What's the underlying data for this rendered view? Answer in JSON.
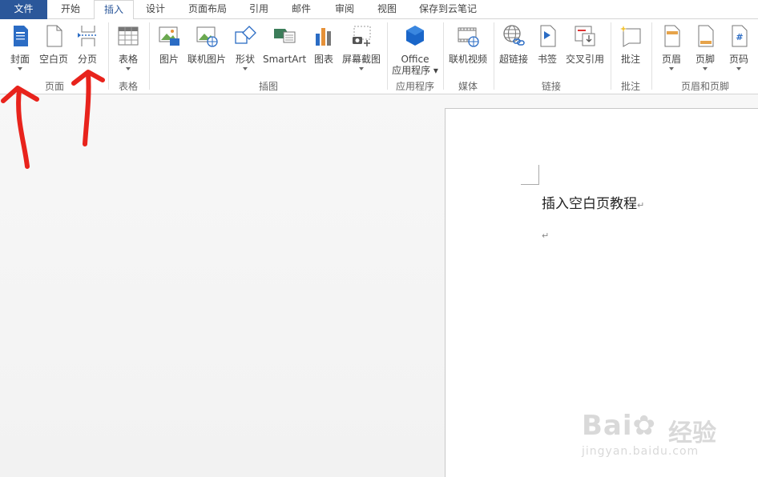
{
  "tabs": [
    "文件",
    "开始",
    "插入",
    "设计",
    "页面布局",
    "引用",
    "邮件",
    "审阅",
    "视图",
    "保存到云笔记"
  ],
  "active_tab": "插入",
  "ribbon": {
    "page_group": {
      "label": "页面",
      "cover": "封面",
      "blank_page": "空白页",
      "page_break": "分页"
    },
    "table_group": {
      "label": "表格",
      "table": "表格"
    },
    "illustrations_group": {
      "label": "插图",
      "picture": "图片",
      "online_picture": "联机图片",
      "shapes": "形状",
      "smartart": "SmartArt",
      "chart": "图表",
      "screenshot": "屏幕截图"
    },
    "apps_group": {
      "label": "应用程序",
      "office_line1": "Office",
      "office_line2": "应用程序"
    },
    "media_group": {
      "label": "媒体",
      "online_video": "联机视频"
    },
    "links_group": {
      "label": "链接",
      "hyperlink": "超链接",
      "bookmark": "书签",
      "cross_reference": "交叉引用"
    },
    "comments_group": {
      "label": "批注",
      "comment": "批注"
    },
    "header_footer_group": {
      "label": "页眉和页脚",
      "header": "页眉",
      "footer": "页脚",
      "page_number": "页码"
    }
  },
  "document": {
    "line1": "插入空白页教程",
    "paragraph_mark": "↵"
  },
  "watermark": {
    "brand": "Bai",
    "brand_tail": "经验",
    "url": "jingyan.baidu.com"
  },
  "colors": {
    "file_tab": "#2b579a",
    "accent": "#2b579a",
    "annotation_arrow": "#e8231c"
  }
}
